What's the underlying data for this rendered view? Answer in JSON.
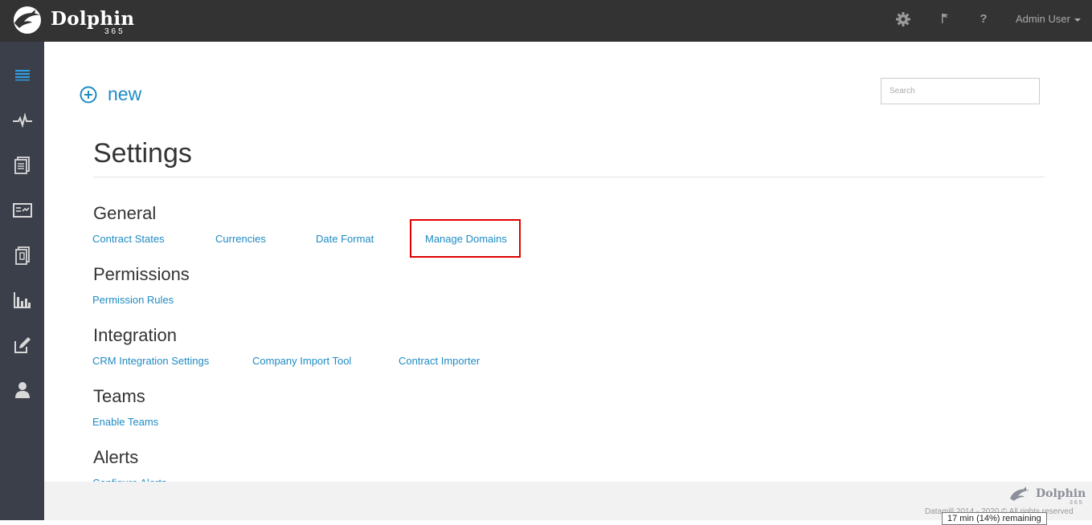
{
  "header": {
    "brand": "Dolphin",
    "brand_sub": "365",
    "icons": [
      "gear-icon",
      "flag-icon",
      "help-icon"
    ],
    "help_glyph": "?",
    "user_label": "Admin User"
  },
  "sidebar": {
    "items": [
      {
        "icon": "menu-icon",
        "active": true
      },
      {
        "icon": "activity-icon"
      },
      {
        "icon": "documents-icon"
      },
      {
        "icon": "contract-card-icon"
      },
      {
        "icon": "invoice-icon"
      },
      {
        "icon": "reports-chart-icon"
      },
      {
        "icon": "edit-icon"
      },
      {
        "icon": "user-icon"
      }
    ]
  },
  "toolbar": {
    "new_label": "new",
    "search_placeholder": "Search"
  },
  "page": {
    "title": "Settings"
  },
  "sections": [
    {
      "title": "General",
      "links": [
        "Contract States",
        "Currencies",
        "Date Format",
        "Manage Domains"
      ]
    },
    {
      "title": "Permissions",
      "links": [
        "Permission Rules"
      ]
    },
    {
      "title": "Integration",
      "links": [
        "CRM Integration Settings",
        "Company Import Tool",
        "Contract Importer"
      ]
    },
    {
      "title": "Teams",
      "links": [
        "Enable Teams"
      ]
    },
    {
      "title": "Alerts",
      "links": [
        "Configure Alerts"
      ]
    }
  ],
  "footer": {
    "brand": "Dolphin",
    "brand_sub": "365",
    "copyright": "Datamill 2014 - 2020 © All rights reserved"
  },
  "tooltip": {
    "text": "17 min (14%) remaining"
  },
  "colors": {
    "topbar": "#333333",
    "sidebar": "#3b3f4a",
    "link": "#1e8bc3",
    "accent_active": "#2f9ee0",
    "highlight": "#e00000"
  }
}
